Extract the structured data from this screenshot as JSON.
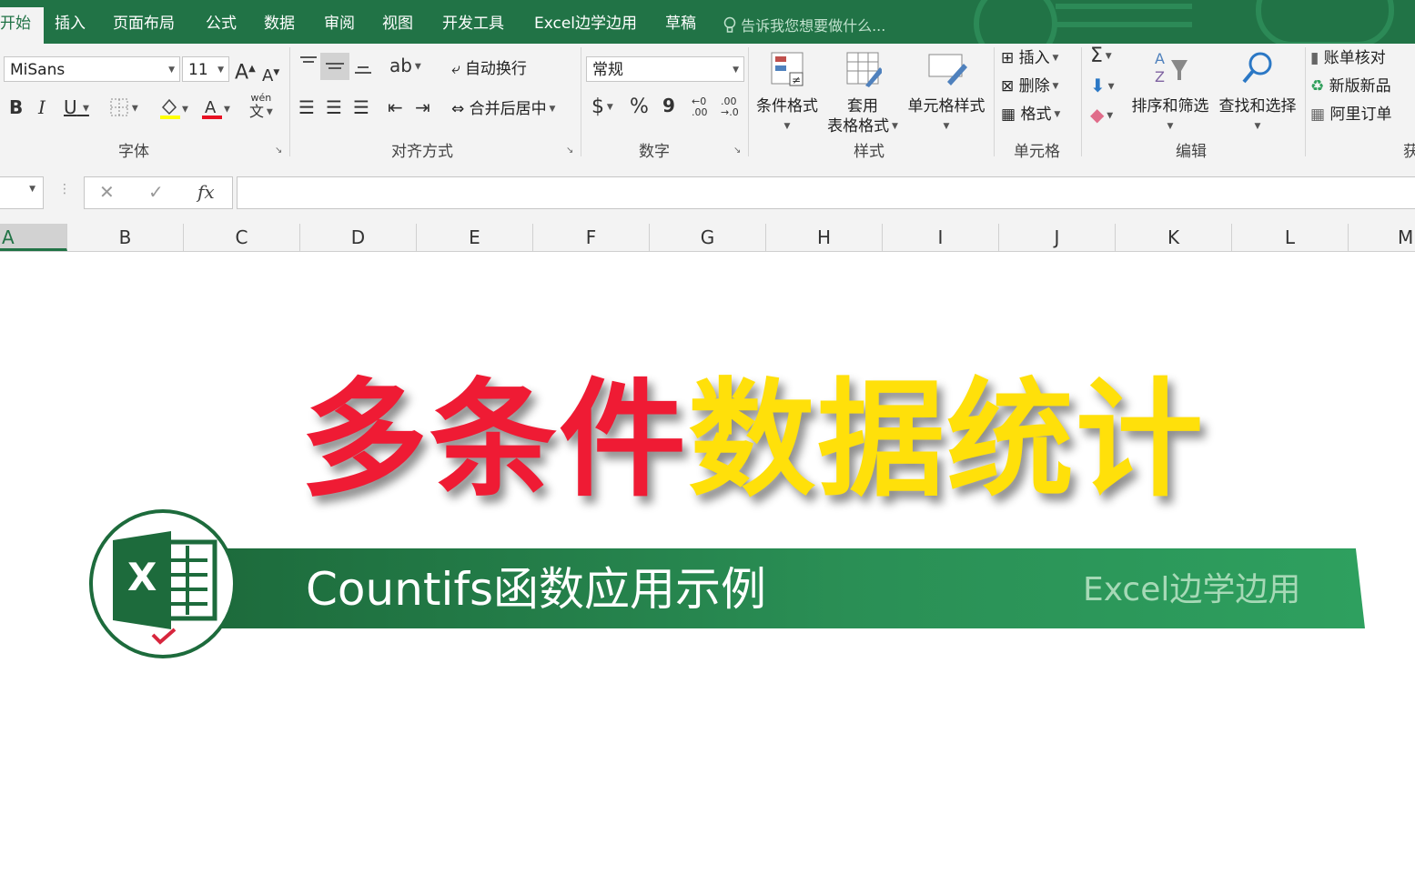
{
  "tabs": [
    "开始",
    "插入",
    "页面布局",
    "公式",
    "数据",
    "审阅",
    "视图",
    "开发工具",
    "Excel边学边用",
    "草稿"
  ],
  "tell_me": "告诉我您想要做什么...",
  "font": {
    "name": "MiSans",
    "size": "11",
    "group_label": "字体",
    "bold": "B",
    "italic": "I",
    "underline": "U",
    "grow": "A",
    "shrink": "A",
    "phonetic_top": "wén",
    "phonetic_bottom": "文"
  },
  "alignment": {
    "wrap_text": "自动换行",
    "merge_center": "合并后居中",
    "group_label": "对齐方式"
  },
  "number": {
    "format": "常规",
    "currency": "$",
    "percent": "%",
    "comma": "9",
    "inc_top": "←0",
    "inc_bottom": ".00",
    "dec_top": ".00",
    "dec_bottom": "→.0",
    "group_label": "数字"
  },
  "styles": {
    "conditional": "条件格式",
    "table_line1": "套用",
    "table_line2": "表格格式",
    "cell_styles": "单元格样式",
    "group_label": "样式"
  },
  "cells": {
    "insert": "插入",
    "delete": "删除",
    "format": "格式",
    "group_label": "单元格"
  },
  "editing": {
    "sum": "Σ",
    "sort_filter": "排序和筛选",
    "find_select": "查找和选择",
    "group_label": "编辑"
  },
  "addins": {
    "reconcile": "账单核对",
    "new_product": "新版新品",
    "ali_order": "阿里订单",
    "group_label": "获"
  },
  "formula_bar": {
    "cancel": "✕",
    "enter": "✓",
    "fx": "fx"
  },
  "columns": [
    "A",
    "B",
    "C",
    "D",
    "E",
    "F",
    "G",
    "H",
    "I",
    "J",
    "K",
    "L",
    "M"
  ],
  "banner": {
    "title_red": "多条件",
    "title_yellow": "数据统计",
    "subtitle": "Countifs函数应用示例",
    "brand": "Excel边学边用",
    "logo_letter": "X",
    "colors": {
      "red": "#ef1b34",
      "yellow": "#ffe00a",
      "green": "#217346"
    }
  }
}
